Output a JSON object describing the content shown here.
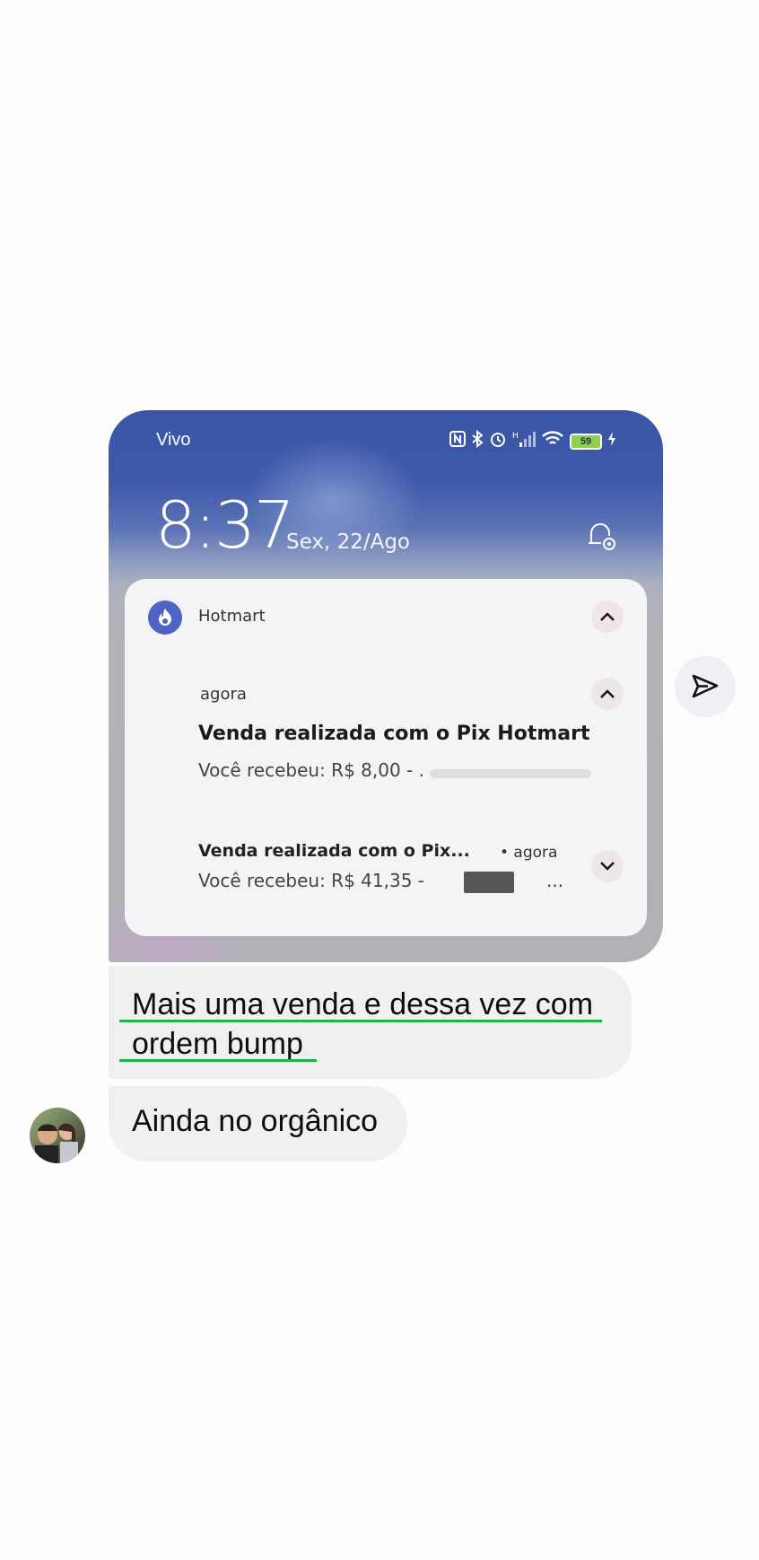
{
  "notification_screenshot": {
    "carrier": "Vivo",
    "battery": "59",
    "clock": "8:37",
    "date": "Sex, 22/Ago",
    "app_name": "Hotmart",
    "notif1": {
      "when": "agora",
      "title": "Venda realizada com o Pix Hotmart",
      "body": "Você recebeu: R$ 8,00 - ."
    },
    "notif2": {
      "title": "Venda realizada com o Pix...",
      "when": "• agora",
      "body": "Você recebeu: R$ 41,35 -",
      "body_tail": "..."
    }
  },
  "messages": [
    {
      "text": "Mais uma venda e dessa vez com ordem bump"
    },
    {
      "text": "Ainda no orgânico"
    }
  ],
  "colors": {
    "underline": "#21b14a",
    "bubble": "#eff0f2",
    "app_icon": "#4e63c4"
  },
  "icons": {
    "share": "send-icon",
    "notif_app": "hotmart-flame-icon",
    "bell": "bell-settings-icon"
  }
}
